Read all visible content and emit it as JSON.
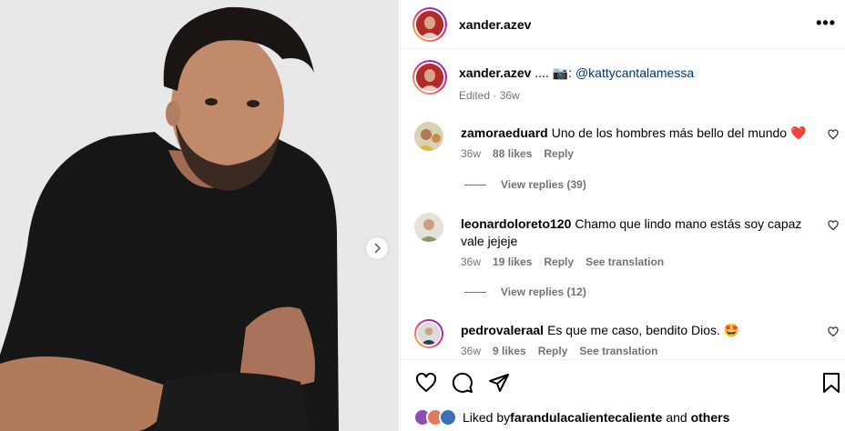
{
  "post": {
    "username": "xander.azev",
    "more_icon": "more-horizontal-icon"
  },
  "caption": {
    "username": "xander.azev",
    "text_prefix": " .... 📷: ",
    "mention": "@kattycantalamessa",
    "meta": "Edited · 36w"
  },
  "comments": [
    {
      "username": "zamoraeduard",
      "text": "Uno de los hombres más bello del mundo ❤️",
      "time": "36w",
      "likes": "88 likes",
      "reply": "Reply",
      "translation": "",
      "view_replies": "View replies (39)"
    },
    {
      "username": "leonardoloreto120",
      "text": "Chamo que lindo mano estás soy capaz vale jejeje",
      "time": "36w",
      "likes": "19 likes",
      "reply": "Reply",
      "translation": "See translation",
      "view_replies": "View replies (12)"
    },
    {
      "username": "pedrovaleraal",
      "text": "Es que me caso, bendito Dios. 🤩",
      "time": "36w",
      "likes": "9 likes",
      "reply": "Reply",
      "translation": "See translation",
      "view_replies": ""
    }
  ],
  "likes_line": {
    "prefix": "Liked by ",
    "user": "farandulacalientecaliente",
    "middle": " and ",
    "others": "others"
  },
  "colors": {
    "mention": "#00376b",
    "meta_gray": "#737373",
    "border": "#efefef"
  }
}
